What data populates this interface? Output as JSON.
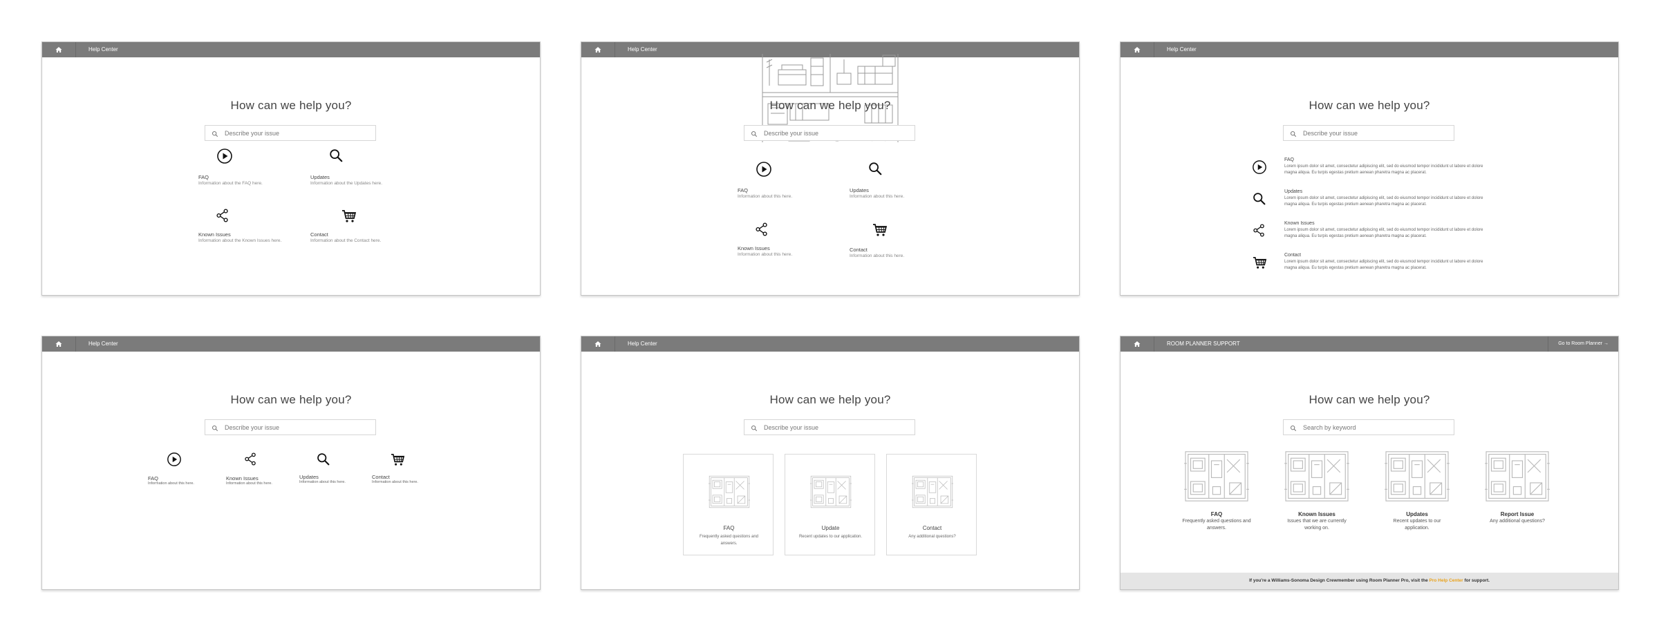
{
  "common": {
    "bar_title": "Help Center",
    "headline": "How can we help you?",
    "search_placeholder": "Describe your issue"
  },
  "panel1": {
    "tiles": [
      {
        "title": "FAQ",
        "desc": "Information about the FAQ here."
      },
      {
        "title": "Updates",
        "desc": "Information about the Updates here."
      },
      {
        "title": "Known Issues",
        "desc": "Information about the Known Issues here."
      },
      {
        "title": "Contact",
        "desc": "Information about the Contact here."
      }
    ]
  },
  "panel2": {
    "tiles": [
      {
        "title": "FAQ",
        "desc": "Information about this here."
      },
      {
        "title": "Updates",
        "desc": "Information about this here."
      },
      {
        "title": "Known Issues",
        "desc": "Information about this here."
      },
      {
        "title": "Contact",
        "desc": "Information about this here."
      }
    ]
  },
  "panel3": {
    "rows": [
      {
        "title": "FAQ",
        "desc": "Lorem ipsum dolor sit amet, consectetur adipiscing elit, sed do eiusmod tempor incididunt ut labore et dolore magna aliqua. Eu turpis egestas pretium aenean pharetra magna ac placerat."
      },
      {
        "title": "Updates",
        "desc": "Lorem ipsum dolor sit amet, consectetur adipiscing elit, sed do eiusmod tempor incididunt ut labore et dolore magna aliqua. Eu turpis egestas pretium aenean pharetra magna ac placerat."
      },
      {
        "title": "Known Issues",
        "desc": "Lorem ipsum dolor sit amet, consectetur adipiscing elit, sed do eiusmod tempor incididunt ut labore et dolore magna aliqua. Eu turpis egestas pretium aenean pharetra magna ac placerat."
      },
      {
        "title": "Contact",
        "desc": "Lorem ipsum dolor sit amet, consectetur adipiscing elit, sed do eiusmod tempor incididunt ut labore et dolore magna aliqua. Eu turpis egestas pretium aenean pharetra magna ac placerat."
      }
    ]
  },
  "panel4": {
    "tiles": [
      {
        "title": "FAQ",
        "desc": "Information about this here."
      },
      {
        "title": "Known Issues",
        "desc": "Information about this here."
      },
      {
        "title": "Updates",
        "desc": "Information about this here."
      },
      {
        "title": "Contact",
        "desc": "Information about this here."
      }
    ]
  },
  "panel5": {
    "cards": [
      {
        "title": "FAQ",
        "desc": "Frequently asked questions and answers."
      },
      {
        "title": "Update",
        "desc": "Recent updates to our application."
      },
      {
        "title": "Contact",
        "desc": "Any additional questions?"
      }
    ]
  },
  "panel6": {
    "bar_title": "ROOM PLANNER SUPPORT",
    "bar_link": "Go to Room Planner →",
    "search_placeholder": "Search by keyword",
    "tiles": [
      {
        "title": "FAQ",
        "desc": "Frequently asked questions and answers."
      },
      {
        "title": "Known Issues",
        "desc": "Issues that we are currently working on."
      },
      {
        "title": "Updates",
        "desc": "Recent updates to our application."
      },
      {
        "title": "Report Issue",
        "desc": "Any additional questions?"
      }
    ],
    "footer_pre": "If you're a Williams-Sonoma Design Crewmember using Room Planner Pro, visit the ",
    "footer_link": "Pro Help Center",
    "footer_post": " for support.",
    "link_color": "#e9a21b"
  },
  "colors": {
    "topbar": "#7b7b7b",
    "accent": "#e9a21b"
  },
  "icons": [
    "home-icon",
    "play-icon",
    "search-icon",
    "share-icon",
    "cart-icon",
    "floor-plan-icon"
  ]
}
